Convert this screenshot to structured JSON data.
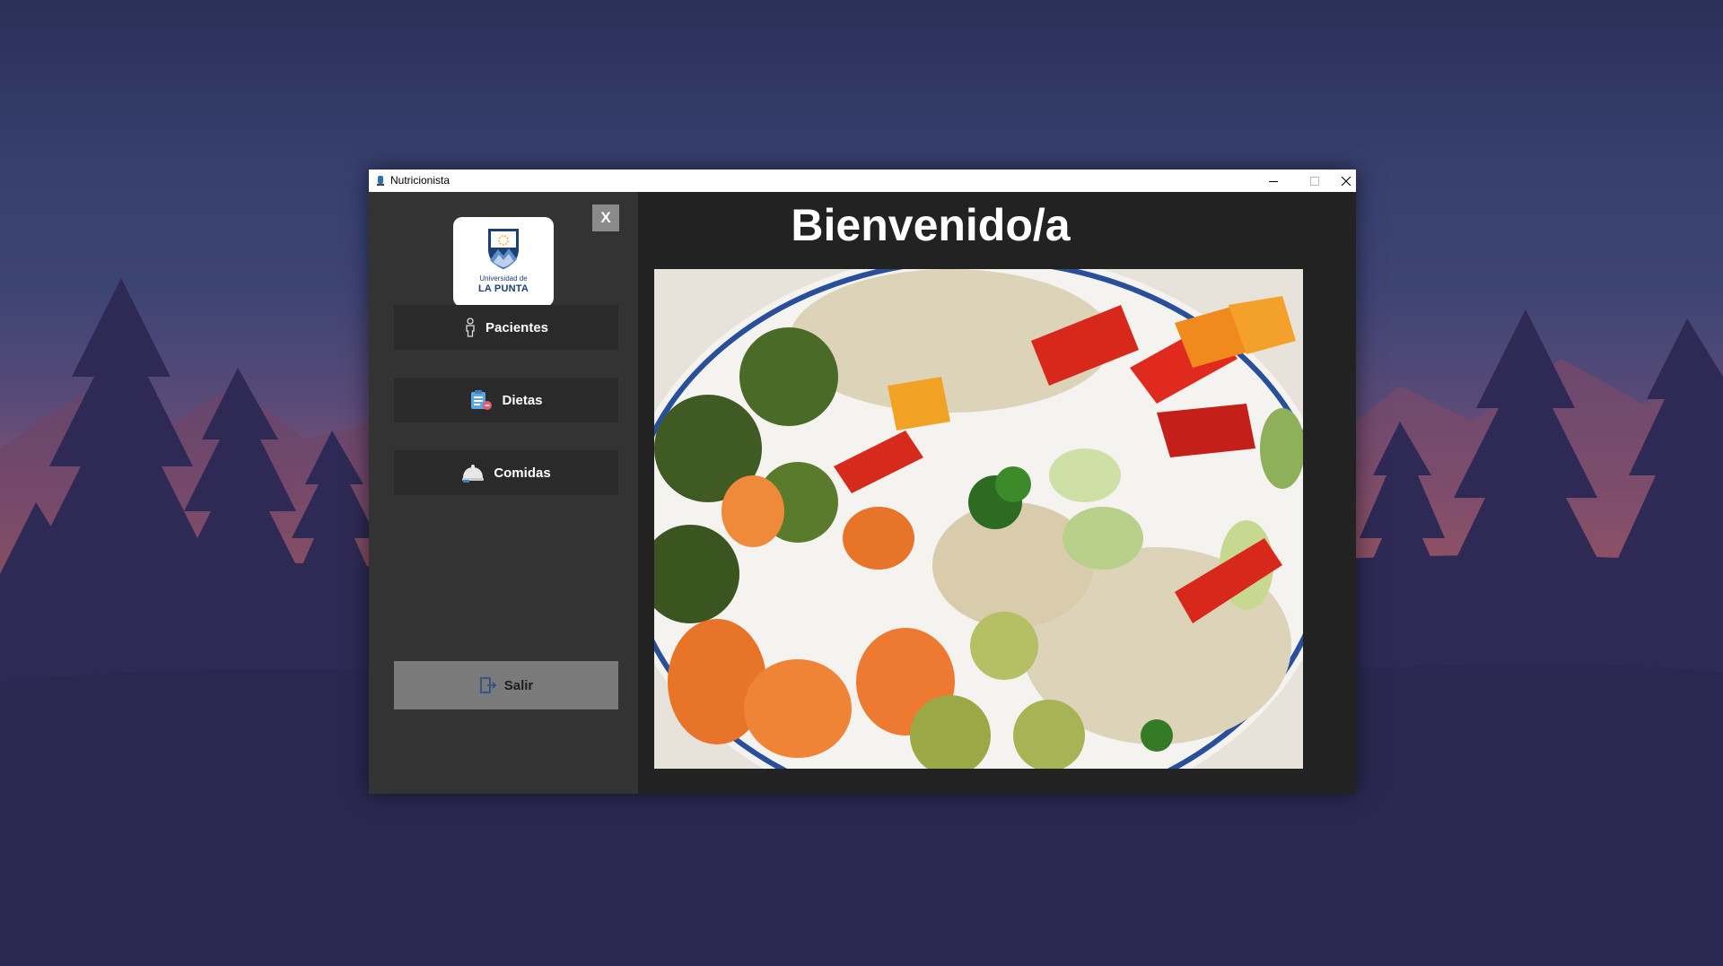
{
  "window": {
    "title": "Nutricionista",
    "controls": [
      "minimize",
      "maximize",
      "close"
    ]
  },
  "sidebar": {
    "close_label": "X",
    "logo": {
      "line1": "Universidad de",
      "line2": "LA PUNTA"
    },
    "items": [
      {
        "label": "Pacientes",
        "icon": "person-icon"
      },
      {
        "label": "Dietas",
        "icon": "diet-clipboard-icon"
      },
      {
        "label": "Comidas",
        "icon": "food-cloche-icon"
      }
    ],
    "exit": {
      "label": "Salir",
      "icon": "exit-door-icon"
    }
  },
  "main": {
    "heading": "Bienvenido/a",
    "image": "vegetables-bowl-photo"
  },
  "colors": {
    "sidebar_bg": "#333333",
    "main_bg": "#222222",
    "button_bg": "#2a2a2a",
    "exit_bg": "#7a7a7a",
    "logo_blue": "#1c3f74"
  }
}
